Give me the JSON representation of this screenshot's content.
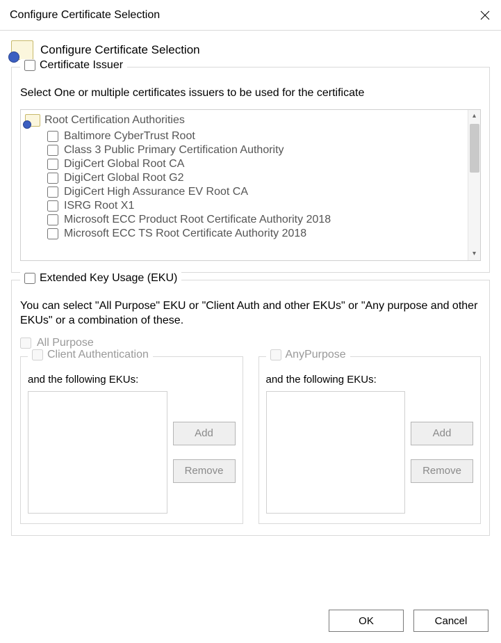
{
  "window": {
    "title": "Configure Certificate Selection"
  },
  "header": {
    "title": "Configure Certificate Selection"
  },
  "issuer": {
    "group_label": "Certificate Issuer",
    "group_checked": false,
    "instruction": "Select One or multiple certificates issuers to be used for the certificate",
    "root_label": "Root Certification Authorities",
    "items": [
      {
        "label": "Baltimore CyberTrust Root",
        "checked": false
      },
      {
        "label": "Class 3 Public Primary Certification Authority",
        "checked": false
      },
      {
        "label": "DigiCert Global Root CA",
        "checked": false
      },
      {
        "label": "DigiCert Global Root G2",
        "checked": false
      },
      {
        "label": "DigiCert High Assurance EV Root CA",
        "checked": false
      },
      {
        "label": "ISRG Root X1",
        "checked": false
      },
      {
        "label": "Microsoft ECC Product Root Certificate Authority 2018",
        "checked": false
      },
      {
        "label": "Microsoft ECC TS Root Certificate Authority 2018",
        "checked": false
      }
    ]
  },
  "eku": {
    "group_label": "Extended Key Usage (EKU)",
    "group_checked": false,
    "instruction": "You can select \"All Purpose\" EKU or \"Client Auth and other EKUs\" or \"Any purpose and other EKUs\" or a combination of these.",
    "all_purpose_label": "All Purpose",
    "client_auth": {
      "legend": "Client Authentication",
      "desc": "and the following EKUs:",
      "add": "Add",
      "remove": "Remove"
    },
    "any_purpose": {
      "legend": "AnyPurpose",
      "desc": "and the following EKUs:",
      "add": "Add",
      "remove": "Remove"
    }
  },
  "footer": {
    "ok": "OK",
    "cancel": "Cancel"
  }
}
